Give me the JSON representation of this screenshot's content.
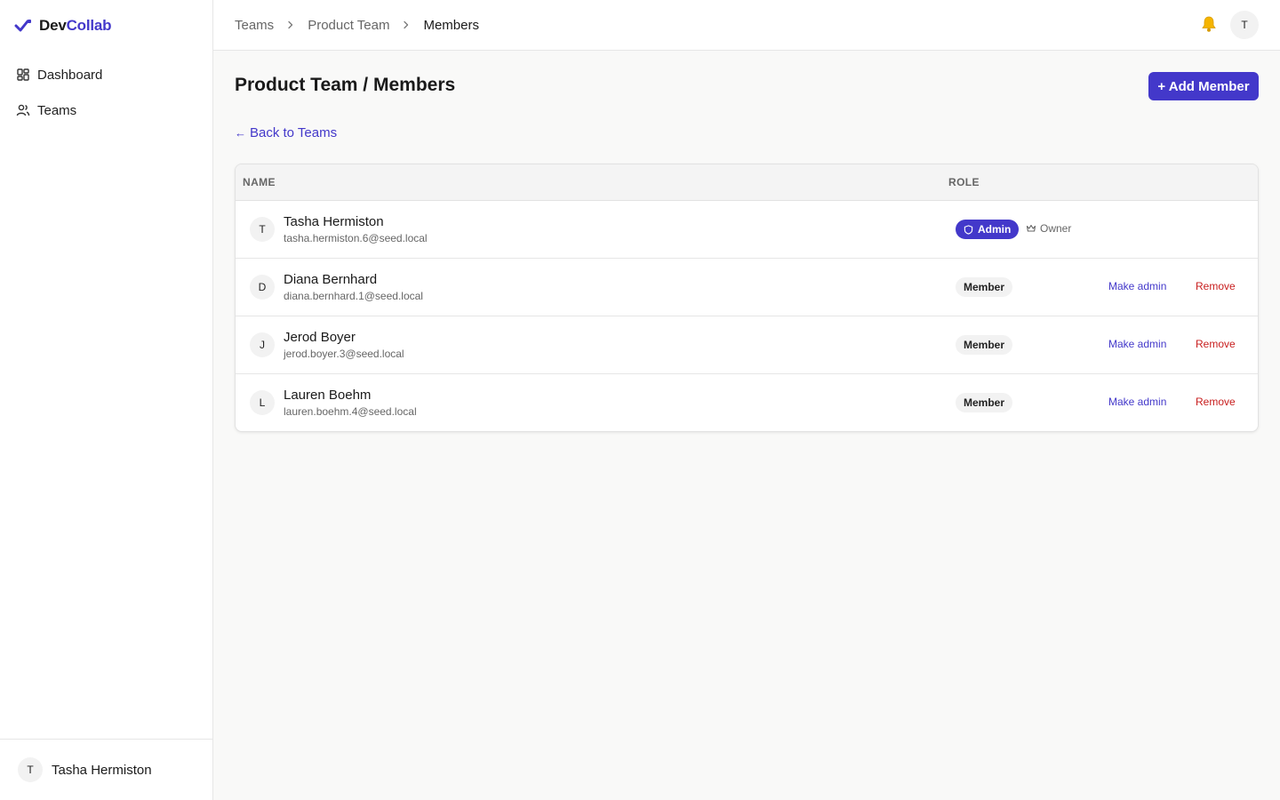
{
  "brand": {
    "prefix": "Dev",
    "suffix": "Collab"
  },
  "sidebar": {
    "items": [
      {
        "label": "Dashboard",
        "icon": "dashboard-icon"
      },
      {
        "label": "Teams",
        "icon": "users-icon"
      }
    ],
    "user": {
      "initial": "T",
      "name": "Tasha Hermiston"
    }
  },
  "header": {
    "breadcrumb": [
      "Teams",
      "Product Team",
      "Members"
    ],
    "avatar_initial": "T"
  },
  "main": {
    "title": "Product Team / Members",
    "add_button": "+ Add Member",
    "back_link": "Back to Teams",
    "back_arrow": "←",
    "table": {
      "headers": {
        "name": "NAME",
        "role": "ROLE"
      },
      "rows": [
        {
          "initial": "T",
          "name": "Tasha Hermiston",
          "email": "tasha.hermiston.6@seed.local",
          "role": "Admin",
          "owner_label": "Owner"
        },
        {
          "initial": "D",
          "name": "Diana Bernhard",
          "email": "diana.bernhard.1@seed.local",
          "role": "Member",
          "make_admin": "Make admin",
          "remove": "Remove"
        },
        {
          "initial": "J",
          "name": "Jerod Boyer",
          "email": "jerod.boyer.3@seed.local",
          "role": "Member",
          "make_admin": "Make admin",
          "remove": "Remove"
        },
        {
          "initial": "L",
          "name": "Lauren Boehm",
          "email": "lauren.boehm.4@seed.local",
          "role": "Member",
          "make_admin": "Make admin",
          "remove": "Remove"
        }
      ]
    }
  },
  "colors": {
    "accent": "#4338ca",
    "danger": "#c81e1e",
    "bell": "#f5b400"
  }
}
